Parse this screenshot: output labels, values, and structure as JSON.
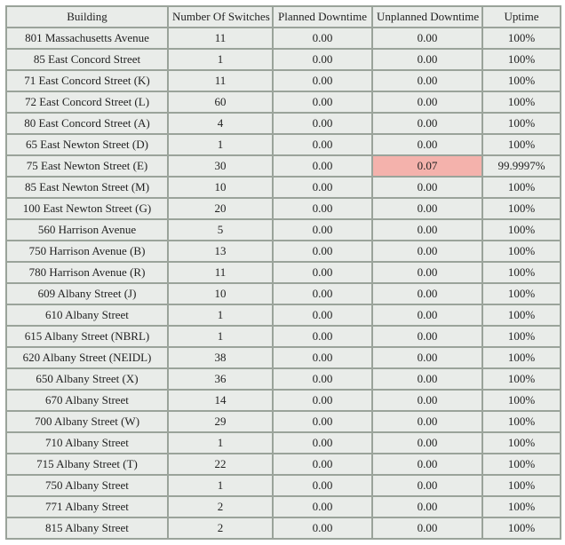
{
  "headers": {
    "building": "Building",
    "switches": "Number Of Switches",
    "planned": "Planned Downtime",
    "unplanned": "Unplanned Downtime",
    "uptime": "Uptime"
  },
  "rows": [
    {
      "building": "801 Massachusetts Avenue",
      "switches": "11",
      "planned": "0.00",
      "unplanned": "0.00",
      "uptime": "100%",
      "flag": false
    },
    {
      "building": "85 East Concord Street",
      "switches": "1",
      "planned": "0.00",
      "unplanned": "0.00",
      "uptime": "100%",
      "flag": false
    },
    {
      "building": "71 East Concord Street (K)",
      "switches": "11",
      "planned": "0.00",
      "unplanned": "0.00",
      "uptime": "100%",
      "flag": false
    },
    {
      "building": "72 East Concord Street (L)",
      "switches": "60",
      "planned": "0.00",
      "unplanned": "0.00",
      "uptime": "100%",
      "flag": false
    },
    {
      "building": "80 East Concord Street (A)",
      "switches": "4",
      "planned": "0.00",
      "unplanned": "0.00",
      "uptime": "100%",
      "flag": false
    },
    {
      "building": "65 East Newton Street (D)",
      "switches": "1",
      "planned": "0.00",
      "unplanned": "0.00",
      "uptime": "100%",
      "flag": false
    },
    {
      "building": "75 East Newton Street (E)",
      "switches": "30",
      "planned": "0.00",
      "unplanned": "0.07",
      "uptime": "99.9997%",
      "flag": true
    },
    {
      "building": "85 East Newton Street (M)",
      "switches": "10",
      "planned": "0.00",
      "unplanned": "0.00",
      "uptime": "100%",
      "flag": false
    },
    {
      "building": "100 East Newton Street (G)",
      "switches": "20",
      "planned": "0.00",
      "unplanned": "0.00",
      "uptime": "100%",
      "flag": false
    },
    {
      "building": "560 Harrison Avenue",
      "switches": "5",
      "planned": "0.00",
      "unplanned": "0.00",
      "uptime": "100%",
      "flag": false
    },
    {
      "building": "750 Harrison Avenue (B)",
      "switches": "13",
      "planned": "0.00",
      "unplanned": "0.00",
      "uptime": "100%",
      "flag": false
    },
    {
      "building": "780 Harrison Avenue (R)",
      "switches": "11",
      "planned": "0.00",
      "unplanned": "0.00",
      "uptime": "100%",
      "flag": false
    },
    {
      "building": "609 Albany Street (J)",
      "switches": "10",
      "planned": "0.00",
      "unplanned": "0.00",
      "uptime": "100%",
      "flag": false
    },
    {
      "building": "610 Albany Street",
      "switches": "1",
      "planned": "0.00",
      "unplanned": "0.00",
      "uptime": "100%",
      "flag": false
    },
    {
      "building": "615 Albany Street (NBRL)",
      "switches": "1",
      "planned": "0.00",
      "unplanned": "0.00",
      "uptime": "100%",
      "flag": false
    },
    {
      "building": "620 Albany Street (NEIDL)",
      "switches": "38",
      "planned": "0.00",
      "unplanned": "0.00",
      "uptime": "100%",
      "flag": false
    },
    {
      "building": "650 Albany Street (X)",
      "switches": "36",
      "planned": "0.00",
      "unplanned": "0.00",
      "uptime": "100%",
      "flag": false
    },
    {
      "building": "670 Albany Street",
      "switches": "14",
      "planned": "0.00",
      "unplanned": "0.00",
      "uptime": "100%",
      "flag": false
    },
    {
      "building": "700 Albany Street (W)",
      "switches": "29",
      "planned": "0.00",
      "unplanned": "0.00",
      "uptime": "100%",
      "flag": false
    },
    {
      "building": "710 Albany Street",
      "switches": "1",
      "planned": "0.00",
      "unplanned": "0.00",
      "uptime": "100%",
      "flag": false
    },
    {
      "building": "715 Albany Street (T)",
      "switches": "22",
      "planned": "0.00",
      "unplanned": "0.00",
      "uptime": "100%",
      "flag": false
    },
    {
      "building": "750 Albany Street",
      "switches": "1",
      "planned": "0.00",
      "unplanned": "0.00",
      "uptime": "100%",
      "flag": false
    },
    {
      "building": "771 Albany Street",
      "switches": "2",
      "planned": "0.00",
      "unplanned": "0.00",
      "uptime": "100%",
      "flag": false
    },
    {
      "building": "815 Albany Street",
      "switches": "2",
      "planned": "0.00",
      "unplanned": "0.00",
      "uptime": "100%",
      "flag": false
    }
  ]
}
